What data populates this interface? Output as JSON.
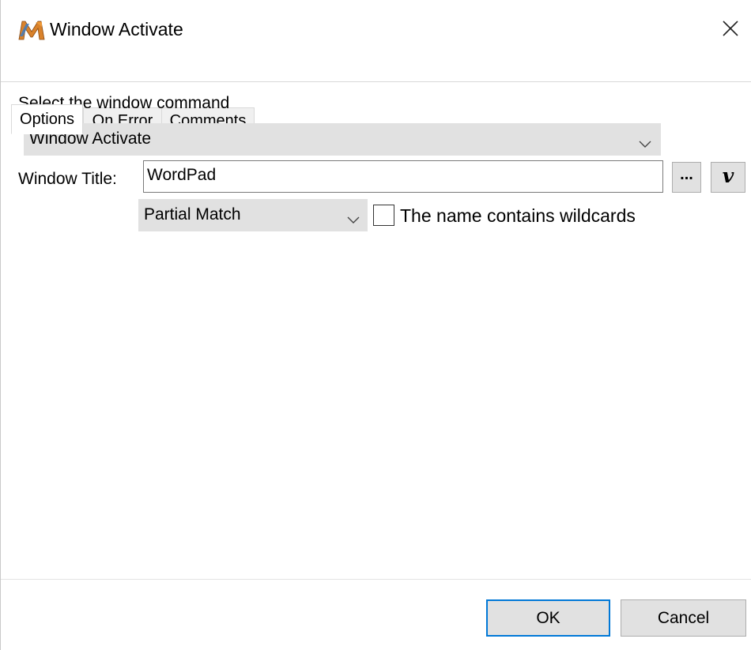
{
  "window": {
    "title": "Window Activate",
    "icon": "macro-app-icon"
  },
  "tabs": [
    {
      "label": "Options",
      "active": true
    },
    {
      "label": "On Error",
      "active": false
    },
    {
      "label": "Comments",
      "active": false
    }
  ],
  "options": {
    "select_command_label": "Select the window command",
    "command_value": "Window Activate",
    "window_title_label": "Window Title:",
    "window_title_value": "WordPad",
    "browse_label": "...",
    "variable_label": "v",
    "match_value": "Partial Match",
    "wildcards_label": "The name contains wildcards",
    "wildcards_checked": false
  },
  "footer": {
    "ok_label": "OK",
    "cancel_label": "Cancel"
  },
  "colors": {
    "accent": "#0078d7",
    "button_face": "#e1e1e1"
  }
}
